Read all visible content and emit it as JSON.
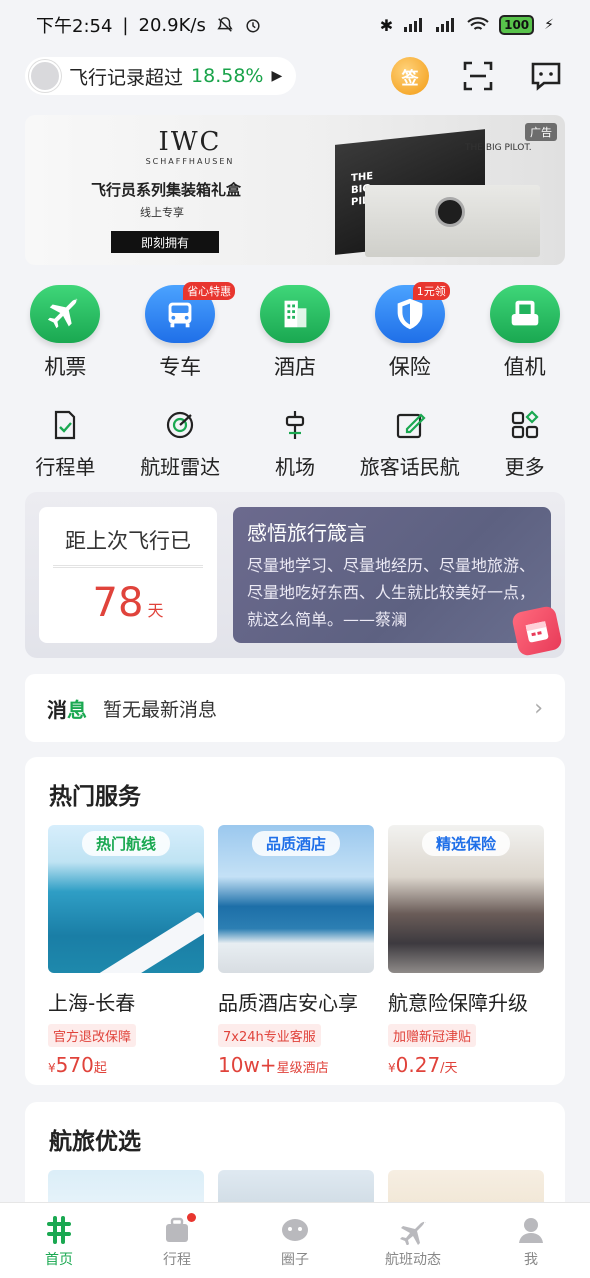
{
  "status_bar": {
    "time": "下午2:54",
    "net_speed": "20.9K/s",
    "battery": "100"
  },
  "header": {
    "record_prefix": "飞行记录超过",
    "record_value": "18.58%",
    "sign_label": "签"
  },
  "banner": {
    "ad_tag": "广告",
    "brand": "IWC",
    "brand_sub": "SCHAFFHAUSEN",
    "title": "飞行员系列集装箱礼盒",
    "subtitle": "线上专享",
    "cta": "即刻拥有",
    "container_label_line1": "THE",
    "container_label_line2": "BIG",
    "container_label_line3": "PILOT.",
    "gift_label": "THE BIG PILOT."
  },
  "services": [
    {
      "label": "机票",
      "icon": "plane-icon",
      "color": "green"
    },
    {
      "label": "专车",
      "icon": "car-icon",
      "color": "blue",
      "badge": "省心特惠"
    },
    {
      "label": "酒店",
      "icon": "hotel-icon",
      "color": "green"
    },
    {
      "label": "保险",
      "icon": "shield-icon",
      "color": "blue",
      "badge": "1元领"
    },
    {
      "label": "值机",
      "icon": "seat-icon",
      "color": "green"
    }
  ],
  "tools": [
    {
      "label": "行程单",
      "icon": "itinerary-icon"
    },
    {
      "label": "航班雷达",
      "icon": "radar-icon"
    },
    {
      "label": "机场",
      "icon": "airport-icon"
    },
    {
      "label": "旅客话民航",
      "icon": "feedback-icon"
    },
    {
      "label": "更多",
      "icon": "grid-icon"
    }
  ],
  "flight_stats": {
    "since_title": "距上次飞行已",
    "since_days": "78",
    "since_unit": "天",
    "quote_title": "感悟旅行箴言",
    "quote_text": "尽量地学习、尽量地经历、尽量地旅游、尽量地吃好东西、人生就比较美好一点，就这么简单。——蔡澜"
  },
  "messages": {
    "label_part1": "消",
    "label_part2": "息",
    "text": "暂无最新消息"
  },
  "hot_services": {
    "title": "热门服务",
    "items": [
      {
        "tag": "热门航线",
        "name": "上海-长春",
        "badge": "官方退改保障",
        "currency": "¥",
        "price": "570",
        "suffix": "起"
      },
      {
        "tag": "品质酒店",
        "name": "品质酒店安心享",
        "badge": "7x24h专业客服",
        "currency": "",
        "price": "10w+",
        "suffix": "星级酒店"
      },
      {
        "tag": "精选保险",
        "name": "航意险保障升级",
        "badge": "加赠新冠津贴",
        "currency": "¥",
        "price": "0.27",
        "suffix": "/天"
      }
    ]
  },
  "travel_picks": {
    "title": "航旅优选"
  },
  "bottom_nav": [
    {
      "label": "首页",
      "icon": "home-icon",
      "active": true
    },
    {
      "label": "行程",
      "icon": "trip-icon"
    },
    {
      "label": "圈子",
      "icon": "circle-icon"
    },
    {
      "label": "航班动态",
      "icon": "flight-status-icon"
    },
    {
      "label": "我",
      "icon": "profile-icon"
    }
  ],
  "colors": {
    "brand_green": "#1aa851",
    "accent_red": "#e0433b",
    "service_blue": "#1f6fe8"
  }
}
